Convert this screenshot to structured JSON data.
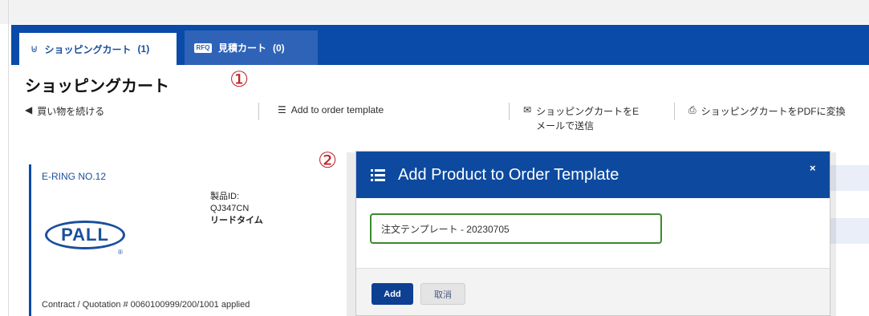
{
  "tabs": {
    "cart": {
      "label": "ショッピングカート",
      "count": "(1)",
      "icon": "cart-icon"
    },
    "quote": {
      "label": "見積カート",
      "count": "(0)",
      "icon": "quote-icon",
      "icon_text": "RFQ"
    }
  },
  "page": {
    "title": "ショッピングカート"
  },
  "annotations": {
    "step1": "①",
    "step2": "②"
  },
  "actions": {
    "continue_shopping": "買い物を続ける",
    "add_to_template": "Add to order template",
    "email_cart_line1": "ショッピングカートをE",
    "email_cart_line2": "メールで送信",
    "pdf_cart": "ショッピングカートをPDFに変換"
  },
  "product": {
    "name": "E-RING NO.12",
    "id_label": "製品ID:",
    "id_value": "QJ347CN",
    "lead_time_label": "リードタイム",
    "brand": "PALL",
    "contract_note": "Contract / Quotation # 0060100999/200/1001 applied"
  },
  "modal": {
    "title": "Add Product to Order Template",
    "close": "×",
    "input_value": "注文テンプレート - 20230705",
    "add_label": "Add",
    "cancel_label": "取消"
  },
  "colors": {
    "brand_blue": "#0a4aa8",
    "annotation_red": "#c0262d",
    "input_border": "#3c8a2e"
  }
}
